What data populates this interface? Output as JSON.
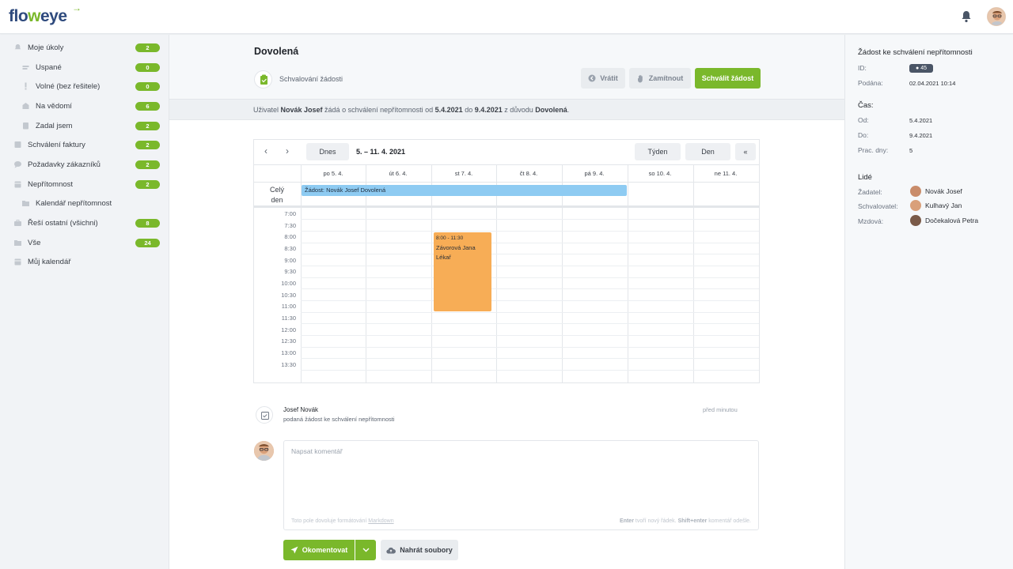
{
  "app": {
    "logo_text_a": "flo",
    "logo_text_b": "w",
    "logo_text_c": "eye"
  },
  "colors": {
    "accent": "#7ab82b",
    "brand": "#2e4a7d",
    "event_blue": "#8ecbf2",
    "event_orange": "#f7ad56"
  },
  "sidebar": {
    "items": [
      {
        "label": "Moje úkoly",
        "count": "2",
        "icon": "bell-icon"
      },
      {
        "label": "Uspané",
        "count": "0",
        "icon": "sleep-icon"
      },
      {
        "label": "Volné (bez řešitele)",
        "count": "0",
        "icon": "exclamation-icon"
      },
      {
        "label": "Na vědomí",
        "count": "6",
        "icon": "inbox-icon"
      },
      {
        "label": "Zadal jsem",
        "count": "2",
        "icon": "clipboard-icon"
      },
      {
        "label": "Schválení faktury",
        "count": "2",
        "icon": "invoice-icon"
      },
      {
        "label": "Požadavky zákazníků",
        "count": "2",
        "icon": "chat-icon"
      },
      {
        "label": "Nepřítomnost",
        "count": "2",
        "icon": "calendar-icon"
      },
      {
        "label": "Kalendář nepřítomnost",
        "icon": "folder-icon"
      },
      {
        "label": "Řeší ostatní (všichni)",
        "count": "8",
        "icon": "briefcase-icon"
      },
      {
        "label": "Vše",
        "count": "24",
        "icon": "folder-icon"
      },
      {
        "label": "Můj kalendář",
        "icon": "calendar-icon"
      }
    ]
  },
  "main": {
    "title": "Dovolená",
    "status_label": "Schvalování žádosti",
    "buttons": {
      "return": "Vrátit",
      "reject": "Zamítnout",
      "approve": "Schválit žádost"
    },
    "info": {
      "p1": "Uživatel ",
      "user": "Novák Josef",
      "p2": " žádá o schválení nepřítomnosti od ",
      "from": "5.4.2021",
      "p3": " do ",
      "to": "9.4.2021",
      "p4": " z důvodu ",
      "reason": "Dovolená",
      "p5": "."
    }
  },
  "calendar": {
    "today_label": "Dnes",
    "range": "5. – 11. 4. 2021",
    "week_label": "Týden",
    "day_label": "Den",
    "collapse_label": "«",
    "days": [
      "po 5. 4.",
      "út 6. 4.",
      "st 7. 4.",
      "čt 8. 4.",
      "pá 9. 4.",
      "so 10. 4.",
      "ne 11. 4."
    ],
    "allday_label_1": "Celý",
    "allday_label_2": "den",
    "allday_event": "Žádost: Novák Josef Dovolená",
    "times": [
      "7:00",
      "7:30",
      "8:00",
      "8:30",
      "9:00",
      "9:30",
      "10:00",
      "10:30",
      "11:00",
      "11:30",
      "12:00",
      "12:30",
      "13:00",
      "13:30"
    ],
    "event": {
      "time": "8:00 - 11:30",
      "name": "Závorová Jana",
      "type": "Lékař"
    }
  },
  "activity": {
    "author": "Josef Novák",
    "text": "podaná žádost ke schválení nepřítomnosti",
    "time": "před minutou"
  },
  "comment": {
    "placeholder": "Napsat komentář",
    "hint_left_1": "Toto pole dovoluje formátování ",
    "hint_left_link": "Markdown",
    "hint_right_key1": "Enter",
    "hint_right_1": " tvoří nový řádek. ",
    "hint_right_key2": "Shift+enter",
    "hint_right_2": " komentář odešle.",
    "submit": "Okomentovat",
    "upload": "Nahrát soubory"
  },
  "right_panel": {
    "title": "Žádost ke schválení nepřítomnosti",
    "id_label": "ID:",
    "id_value": "45",
    "submitted_label": "Podána:",
    "submitted_value": "02.04.2021 10:14",
    "time_title": "Čas:",
    "from_label": "Od:",
    "from_value": "5.4.2021",
    "to_label": "Do:",
    "to_value": "9.4.2021",
    "workdays_label": "Prac. dny:",
    "workdays_value": "5",
    "people_title": "Lidé",
    "requester_label": "Žadatel:",
    "requester": "Novák Josef",
    "approver_label": "Schvalovatel:",
    "approver": "Kulhavý Jan",
    "payroll_label": "Mzdová:",
    "payroll": "Dočekalová Petra"
  }
}
